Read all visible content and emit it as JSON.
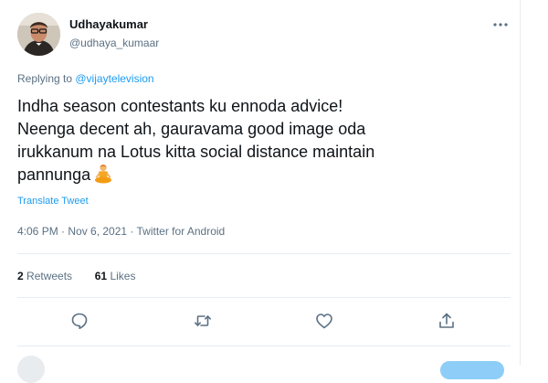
{
  "user": {
    "display_name": "Udhayakumar",
    "handle": "@udhaya_kumaar"
  },
  "reply": {
    "prefix": "Replying to ",
    "mention": "@vijaytelevision"
  },
  "tweet": {
    "lines": [
      "Indha season contestants ku ennoda advice!",
      "Neenga decent ah, gauravama good image oda",
      "irukkanum na Lotus kitta social distance maintain",
      "pannunga"
    ],
    "emoji_icon": "person-in-lotus-position-icon"
  },
  "translate_label": "Translate Tweet",
  "meta": "4:06 PM · Nov 6, 2021 · Twitter for Android",
  "stats": {
    "retweets_count": "2",
    "retweets_label": "Retweets",
    "likes_count": "61",
    "likes_label": "Likes"
  },
  "icons": {
    "more": "more-icon",
    "reply": "reply-icon",
    "retweet": "retweet-icon",
    "like": "heart-icon",
    "share": "share-icon"
  },
  "colors": {
    "link": "#1d9bf0",
    "secondary_text": "#5b7083",
    "primary_text": "#0f1419",
    "divider": "#e6ecf0"
  }
}
